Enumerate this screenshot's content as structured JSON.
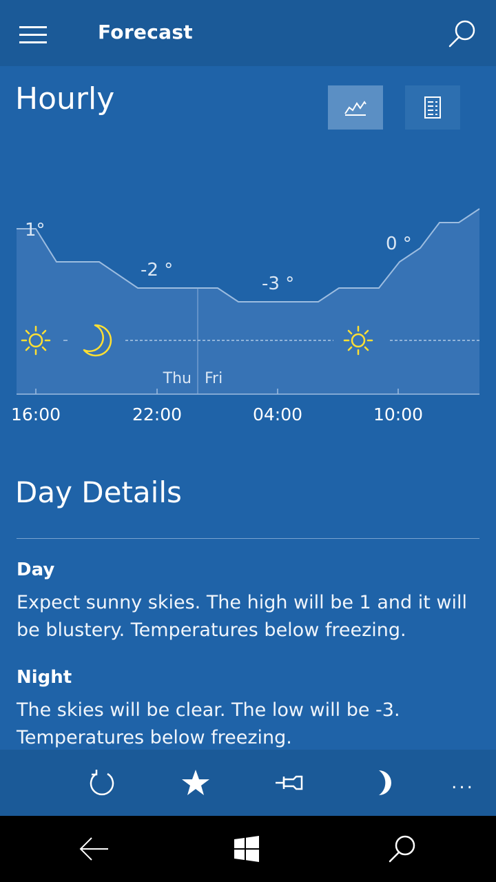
{
  "header": {
    "title": "Forecast"
  },
  "hourly": {
    "title": "Hourly",
    "views": [
      {
        "name": "graph",
        "active": true
      },
      {
        "name": "list",
        "active": false
      }
    ],
    "day_change": {
      "left": "Thu",
      "right": "Fri"
    },
    "temp_labels": [
      {
        "text": "1°",
        "x": 0
      },
      {
        "text": "-2 °",
        "x": 1
      },
      {
        "text": "-3 °",
        "x": 2
      },
      {
        "text": "0 °",
        "x": 3
      }
    ],
    "time_labels": [
      "16:00",
      "22:00",
      "04:00",
      "10:00"
    ],
    "conditions": [
      "sun-icon",
      "moon-icon",
      "sun-icon"
    ]
  },
  "details": {
    "title": "Day Details",
    "day_heading": "Day",
    "day_text": "Expect sunny skies. The high will be 1 and it will be blustery. Temperatures below freezing.",
    "night_heading": "Night",
    "night_text": "The skies will be clear. The low will be -3. Temperatures below freezing."
  },
  "appbar": {
    "items": [
      "refresh-icon",
      "favorite-star-icon",
      "pin-icon",
      "dark-mode-moon-icon",
      "more-icon"
    ],
    "more_label": "..."
  },
  "colors": {
    "background": "#1f63a8",
    "bar": "#1b5a98",
    "accent_icon": "#ffe033"
  }
}
